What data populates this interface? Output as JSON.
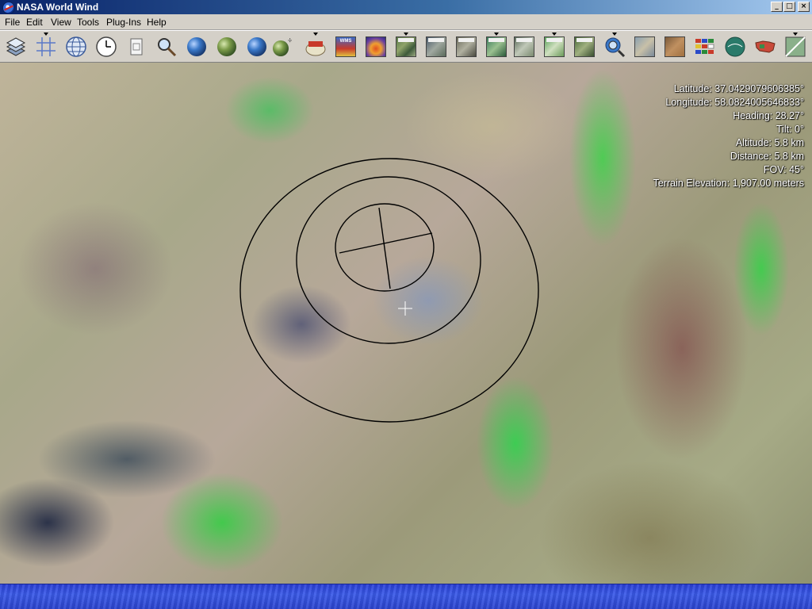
{
  "window": {
    "title": "NASA World Wind",
    "controls": {
      "minimize": "_",
      "maximize": "□",
      "close": "×"
    }
  },
  "menu": [
    "File",
    "Edit",
    "View",
    "Tools",
    "Plug-Ins",
    "Help"
  ],
  "toolbar": {
    "buttons": [
      "layer-manager",
      "lat-lon-grid",
      "place-names",
      "clock",
      "scale-bar",
      "search",
      "blue-marble",
      "blue-marble-next-gen",
      "landsat-globe",
      "srtm-globe",
      "wms-browser",
      "wms-layers",
      "animated-earth",
      "usgs-topo",
      "usgs-urban",
      "usgs-ortho",
      "landsat-7",
      "landsat-pseudo",
      "onearth-landsat",
      "modis",
      "find-place",
      "geocover",
      "flags",
      "globe-boundaries",
      "scenario-editor",
      "usa-map",
      "compass-settings"
    ],
    "small_labels": {
      "wms": "WMS"
    }
  },
  "info": {
    "latitude": "Latitude: 37.0429079606385°",
    "longitude": "Longitude: 58.0824005646833°",
    "heading": "Heading: 28.27°",
    "tilt": "Tilt: 0°",
    "altitude": "Altitude: 5.8 km",
    "distance": "Distance: 5.8 km",
    "fov": "FOV: 45°",
    "terrain": "Terrain Elevation: 1,907.00 meters"
  },
  "colors": {
    "title_gradient_start": "#0a246a",
    "title_gradient_end": "#a6caf0",
    "status_bar": "#2c44d0",
    "overlay_text": "#ffffff"
  }
}
